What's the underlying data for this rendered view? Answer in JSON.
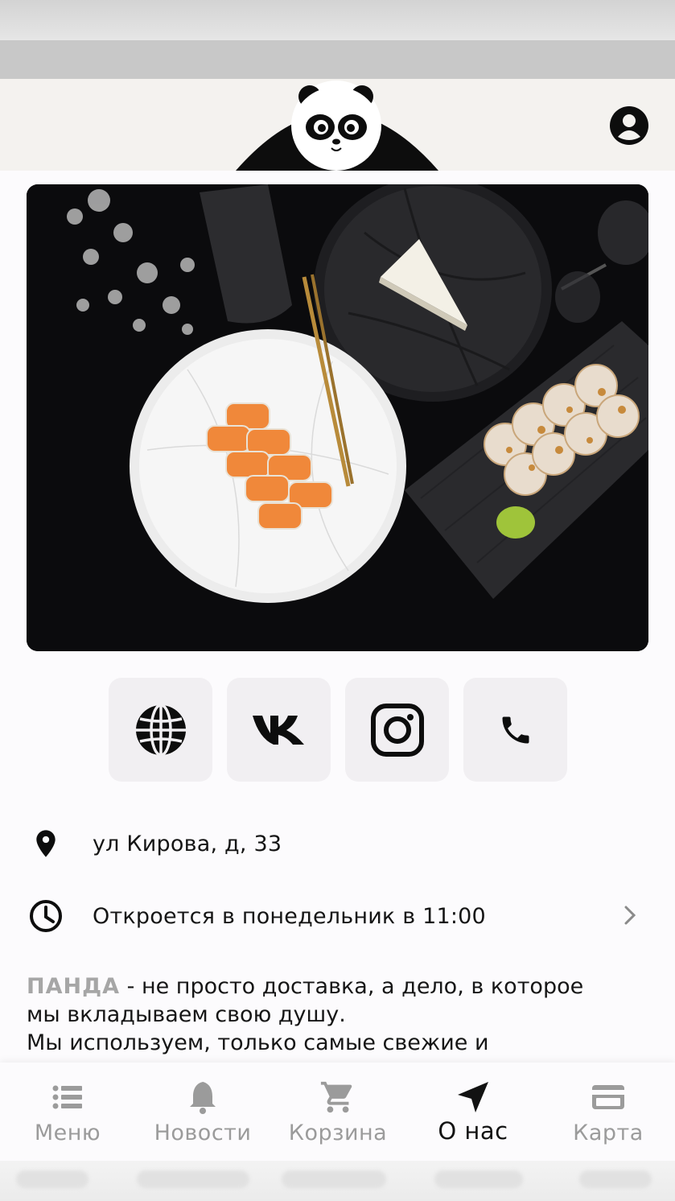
{
  "header": {
    "logo_icon": "panda-logo",
    "profile_icon": "account-circle-icon"
  },
  "hero": {
    "image": "sushi-rolls-on-plates-photo"
  },
  "social": [
    {
      "icon": "globe-icon"
    },
    {
      "icon": "vk-icon"
    },
    {
      "icon": "instagram-icon"
    },
    {
      "icon": "phone-icon"
    }
  ],
  "info": {
    "address": "ул Кирова, д, 33",
    "hours": "Откроется в понедельник в 11:00"
  },
  "about": {
    "brand": "ПАНДА",
    "line1_rest": " - не просто доставка, а дело, в которое",
    "line2": "мы вкладываем свою душу.",
    "line3": "Мы используем, только самые свежие и"
  },
  "tabs": [
    {
      "label": "Меню",
      "icon": "list-icon",
      "active": false
    },
    {
      "label": "Новости",
      "icon": "bell-icon",
      "active": false
    },
    {
      "label": "Корзина",
      "icon": "cart-icon",
      "active": false
    },
    {
      "label": "О нас",
      "icon": "navigation-arrow-icon",
      "active": true
    },
    {
      "label": "Карта",
      "icon": "credit-card-icon",
      "active": false
    }
  ],
  "colors": {
    "active_tab": "#121212",
    "inactive_tab": "#9b9b9b",
    "brand_text": "#a6a6a6"
  }
}
